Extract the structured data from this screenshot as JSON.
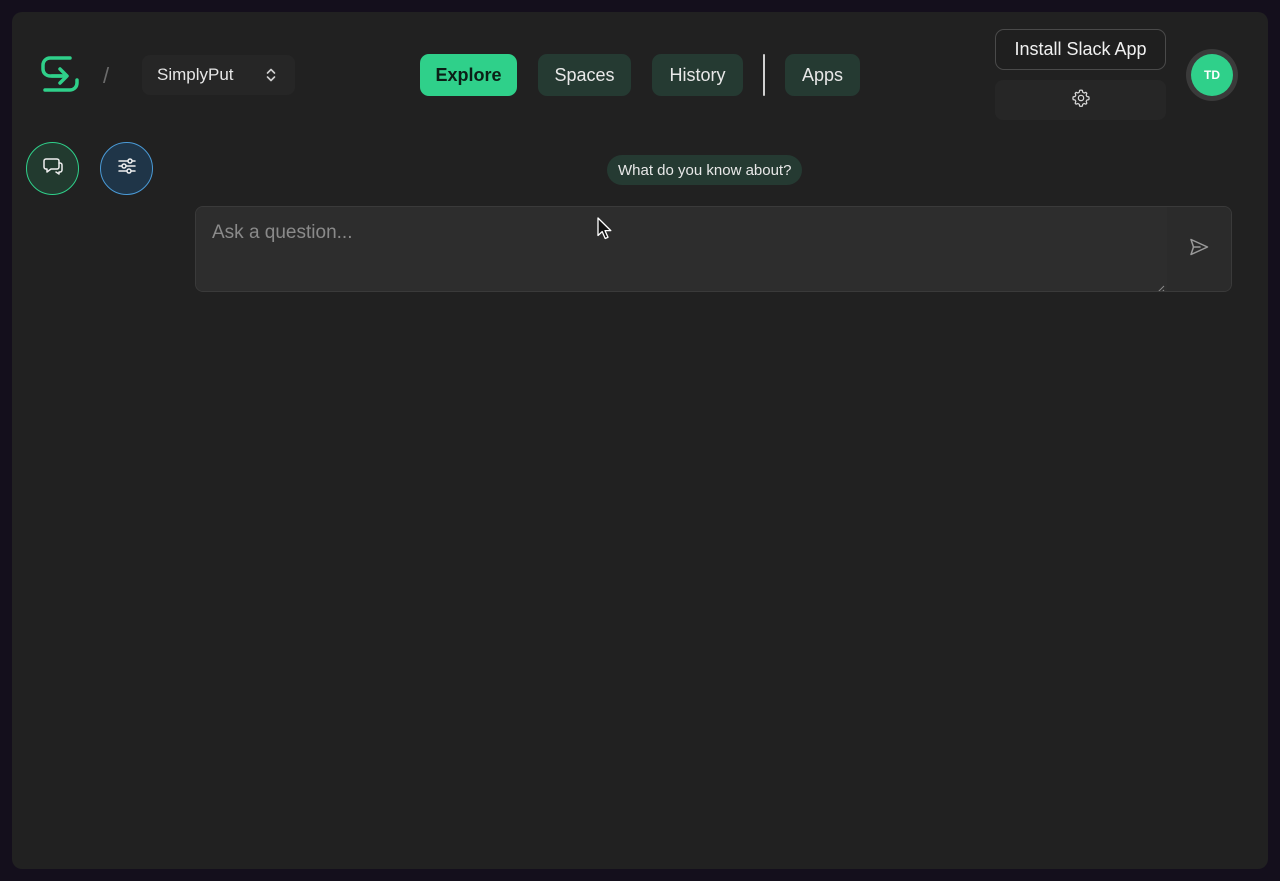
{
  "header": {
    "separator": "/",
    "workspace_name": "SimplyPut",
    "nav": [
      {
        "label": "Explore",
        "active": true
      },
      {
        "label": "Spaces",
        "active": false
      },
      {
        "label": "History",
        "active": false
      },
      {
        "label": "Apps",
        "active": false
      }
    ],
    "install_slack_label": "Install Slack App",
    "avatar_initials": "TD"
  },
  "main": {
    "suggestion_chip": "What do you know about?",
    "ask": {
      "placeholder": "Ask a question...",
      "value": ""
    }
  },
  "icons": {
    "logo": "simplyput-logo-icon",
    "workspace_switch": "chevron-up-down-icon",
    "settings": "gear-icon",
    "chat": "chat-bubbles-icon",
    "filters": "sliders-icon",
    "send": "send-icon"
  },
  "colors": {
    "accent": "#2fd08a",
    "background": "#212121",
    "nav_inactive": "#253a32",
    "filter_accent": "#4a9ad6"
  }
}
